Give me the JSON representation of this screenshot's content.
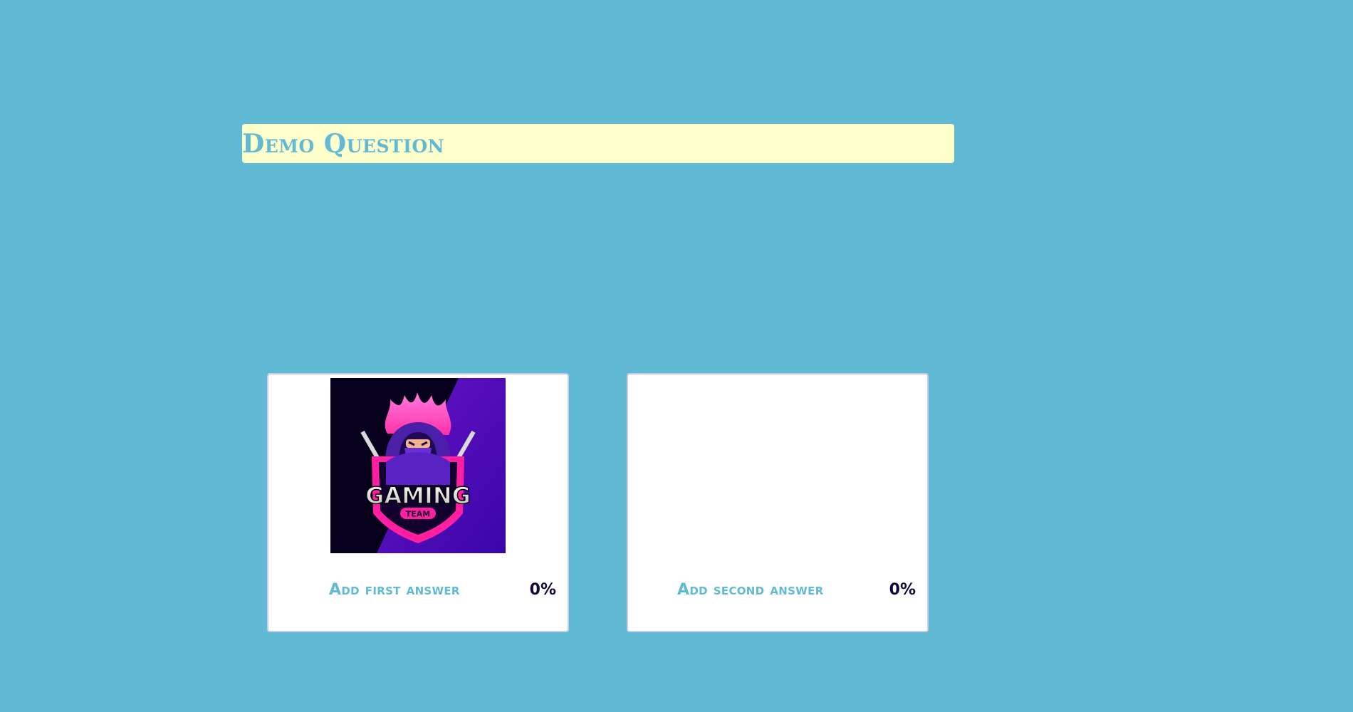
{
  "question": {
    "title": "Demo Question"
  },
  "answers": [
    {
      "label": "Add first answer",
      "percent": "0%",
      "image": "gaming-team-ninja-logo",
      "logo_text": "GAMING",
      "logo_subtext": "TEAM"
    },
    {
      "label": "Add second answer",
      "percent": "0%"
    }
  ],
  "colors": {
    "background": "#61bad4",
    "question_bar": "#ffffcc",
    "accent_text": "#61bad4",
    "percent_text": "#0d0a3a",
    "card_border": "#c5cbe8"
  }
}
